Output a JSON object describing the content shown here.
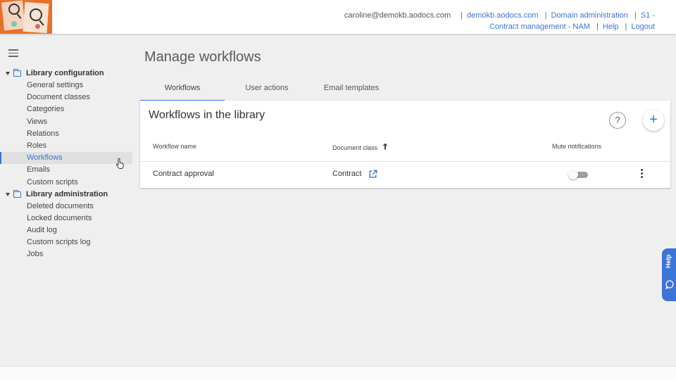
{
  "header": {
    "email": "caroline@demokb.aodocs.com",
    "links_row1": [
      "demokb.aodocs.com",
      "Domain administration",
      "S1 -"
    ],
    "links_row2": [
      "Contract management - NAM",
      "Help",
      "Logout"
    ],
    "separator": "|"
  },
  "sidebar": {
    "groups": [
      {
        "label": "Library configuration",
        "items": [
          "General settings",
          "Document classes",
          "Categories",
          "Views",
          "Relations",
          "Roles",
          "Workflows",
          "Emails",
          "Custom scripts"
        ]
      },
      {
        "label": "Library administration",
        "items": [
          "Deleted documents",
          "Locked documents",
          "Audit log",
          "Custom scripts log",
          "Jobs"
        ]
      }
    ],
    "active_item": "Workflows"
  },
  "main": {
    "page_title": "Manage workflows",
    "tabs": [
      "Workflows",
      "User actions",
      "Email templates"
    ],
    "active_tab": "Workflows",
    "card_title": "Workflows in the library",
    "help_glyph": "?",
    "add_glyph": "+",
    "columns": {
      "name": "Workflow name",
      "doc_class": "Document class",
      "mute": "Mute notifications"
    },
    "rows": [
      {
        "name": "Contract approval",
        "doc_class": "Contract",
        "mute": false
      }
    ]
  },
  "help_tab": {
    "label": "Help"
  },
  "colors": {
    "accent": "#3b73d6",
    "logo_bg": "#e8702a",
    "page_bg": "#efefef"
  }
}
